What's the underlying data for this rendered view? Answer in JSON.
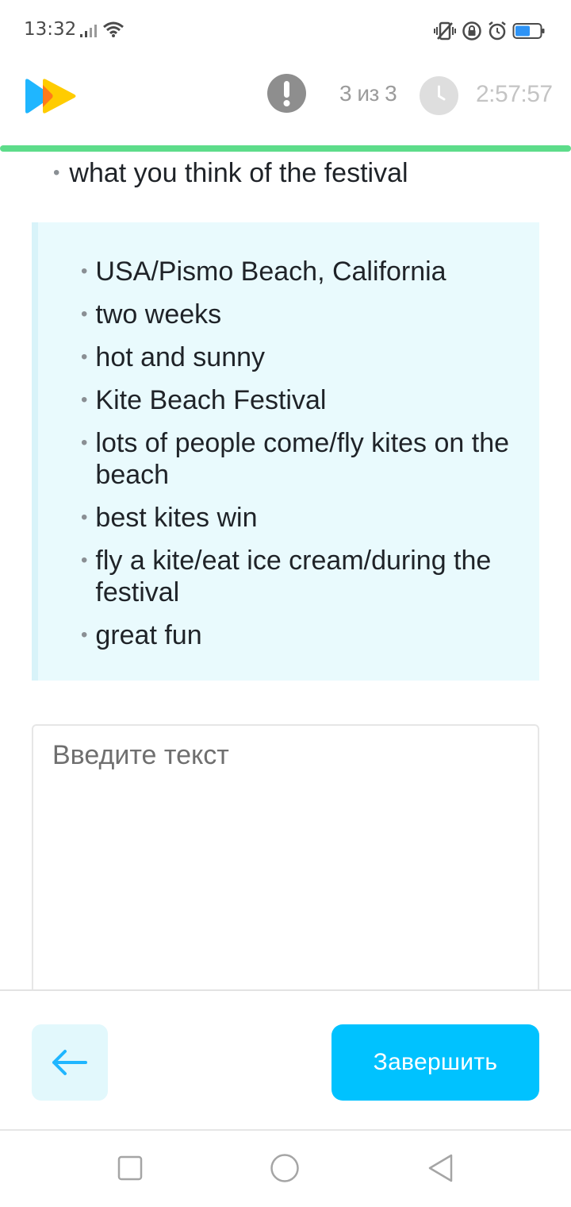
{
  "status_bar": {
    "time": "13:32",
    "icons": [
      "signal-icon",
      "wifi-icon",
      "vibrate-icon",
      "lock-rotation-icon",
      "alarm-icon",
      "battery-icon"
    ],
    "battery_color": "#2e93f5"
  },
  "header": {
    "logo": "play-logo",
    "alert_icon": "exclamation-icon",
    "counter": "3 из 3",
    "clock_icon": "clock-icon",
    "timer": "2:57:57"
  },
  "progress_color": "#5ddc8a",
  "progress_value": 1.0,
  "task": {
    "bullet": "what you think of the festival"
  },
  "hints": [
    "USA/Pismo Beach, California",
    "two weeks",
    "hot and sunny",
    "Kite Beach Festival",
    "lots of people come/fly kites on the beach",
    "best kites win",
    "fly a kite/eat ice cream/during the festival",
    "great fun"
  ],
  "answer": {
    "placeholder": "Введите текст",
    "value": ""
  },
  "footer": {
    "back_icon": "arrow-left-icon",
    "finish_label": "Завершить",
    "accent": "#00c2ff"
  },
  "nav": {
    "icons": [
      "recent-apps-icon",
      "home-icon",
      "back-icon"
    ]
  }
}
